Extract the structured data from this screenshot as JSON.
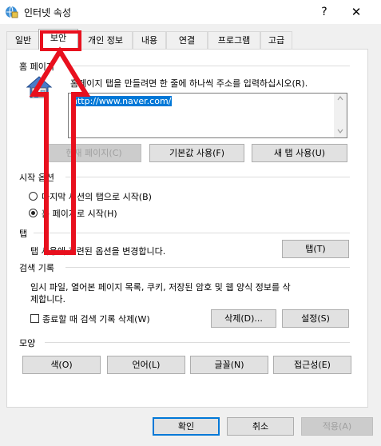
{
  "window": {
    "title": "인터넷 속성",
    "help_glyph": "?",
    "close_glyph": "✕"
  },
  "tabs": [
    "일반",
    "보안",
    "개인 정보",
    "내용",
    "연결",
    "프로그램",
    "고급"
  ],
  "homepage": {
    "section_label": "홈 페이지",
    "description": "홈페이지 탭을 만들려면 한 줄에 하나씩 주소를 입력하십시오(R).",
    "url_value": "http://www.naver.com/",
    "buttons": {
      "use_current": "현재 페이지(C)",
      "use_default": "기본값 사용(F)",
      "use_new_tab": "새 탭 사용(U)"
    }
  },
  "startup": {
    "section_label": "시작 옵션",
    "option_last_session": "마지막 세션의 탭으로 시작(B)",
    "option_homepage": "홈 페이지로 시작(H)",
    "selected": "homepage"
  },
  "tabs_section": {
    "section_label": "탭",
    "description": "탭 사용에 관련된 옵션을 변경합니다.",
    "button": "탭(T)"
  },
  "history": {
    "section_label": "검색 기록",
    "description_line1": "임시 파일, 열어본 페이지 목록, 쿠키, 저장된 암호 및 웹 양식 정보를 삭",
    "description_line2": "제합니다.",
    "delete_on_exit_label": "종료할 때 검색 기록 삭제(W)",
    "delete_on_exit_checked": false,
    "delete_button": "삭제(D)...",
    "settings_button": "설정(S)"
  },
  "appearance": {
    "section_label": "모양",
    "colors_button": "색(O)",
    "languages_button": "언어(L)",
    "fonts_button": "글꼴(N)",
    "accessibility_button": "접근성(E)"
  },
  "footer": {
    "ok": "확인",
    "cancel": "취소",
    "apply": "적용(A)"
  },
  "colors": {
    "annotation_red": "#e8101e",
    "selection_blue": "#0078d7"
  }
}
